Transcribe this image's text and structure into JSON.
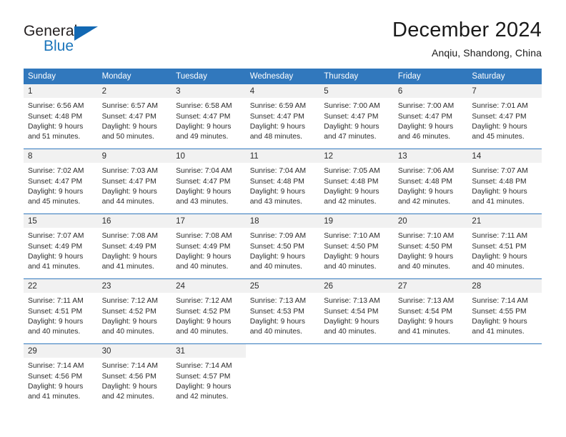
{
  "logo": {
    "word_top": "General",
    "word_bottom": "Blue",
    "triangle_color": "#1268b3",
    "blue_color": "#1b75bb"
  },
  "header": {
    "title": "December 2024",
    "subtitle": "Anqiu, Shandong, China"
  },
  "theme": {
    "header_blue": "#3178bd",
    "day_strip_gray": "#f1f1f1",
    "text": "#2b2b2b"
  },
  "calendar": {
    "weekdays": [
      "Sunday",
      "Monday",
      "Tuesday",
      "Wednesday",
      "Thursday",
      "Friday",
      "Saturday"
    ],
    "weeks": [
      [
        {
          "day": "1",
          "l1": "Sunrise: 6:56 AM",
          "l2": "Sunset: 4:48 PM",
          "l3": "Daylight: 9 hours",
          "l4": "and 51 minutes."
        },
        {
          "day": "2",
          "l1": "Sunrise: 6:57 AM",
          "l2": "Sunset: 4:47 PM",
          "l3": "Daylight: 9 hours",
          "l4": "and 50 minutes."
        },
        {
          "day": "3",
          "l1": "Sunrise: 6:58 AM",
          "l2": "Sunset: 4:47 PM",
          "l3": "Daylight: 9 hours",
          "l4": "and 49 minutes."
        },
        {
          "day": "4",
          "l1": "Sunrise: 6:59 AM",
          "l2": "Sunset: 4:47 PM",
          "l3": "Daylight: 9 hours",
          "l4": "and 48 minutes."
        },
        {
          "day": "5",
          "l1": "Sunrise: 7:00 AM",
          "l2": "Sunset: 4:47 PM",
          "l3": "Daylight: 9 hours",
          "l4": "and 47 minutes."
        },
        {
          "day": "6",
          "l1": "Sunrise: 7:00 AM",
          "l2": "Sunset: 4:47 PM",
          "l3": "Daylight: 9 hours",
          "l4": "and 46 minutes."
        },
        {
          "day": "7",
          "l1": "Sunrise: 7:01 AM",
          "l2": "Sunset: 4:47 PM",
          "l3": "Daylight: 9 hours",
          "l4": "and 45 minutes."
        }
      ],
      [
        {
          "day": "8",
          "l1": "Sunrise: 7:02 AM",
          "l2": "Sunset: 4:47 PM",
          "l3": "Daylight: 9 hours",
          "l4": "and 45 minutes."
        },
        {
          "day": "9",
          "l1": "Sunrise: 7:03 AM",
          "l2": "Sunset: 4:47 PM",
          "l3": "Daylight: 9 hours",
          "l4": "and 44 minutes."
        },
        {
          "day": "10",
          "l1": "Sunrise: 7:04 AM",
          "l2": "Sunset: 4:47 PM",
          "l3": "Daylight: 9 hours",
          "l4": "and 43 minutes."
        },
        {
          "day": "11",
          "l1": "Sunrise: 7:04 AM",
          "l2": "Sunset: 4:48 PM",
          "l3": "Daylight: 9 hours",
          "l4": "and 43 minutes."
        },
        {
          "day": "12",
          "l1": "Sunrise: 7:05 AM",
          "l2": "Sunset: 4:48 PM",
          "l3": "Daylight: 9 hours",
          "l4": "and 42 minutes."
        },
        {
          "day": "13",
          "l1": "Sunrise: 7:06 AM",
          "l2": "Sunset: 4:48 PM",
          "l3": "Daylight: 9 hours",
          "l4": "and 42 minutes."
        },
        {
          "day": "14",
          "l1": "Sunrise: 7:07 AM",
          "l2": "Sunset: 4:48 PM",
          "l3": "Daylight: 9 hours",
          "l4": "and 41 minutes."
        }
      ],
      [
        {
          "day": "15",
          "l1": "Sunrise: 7:07 AM",
          "l2": "Sunset: 4:49 PM",
          "l3": "Daylight: 9 hours",
          "l4": "and 41 minutes."
        },
        {
          "day": "16",
          "l1": "Sunrise: 7:08 AM",
          "l2": "Sunset: 4:49 PM",
          "l3": "Daylight: 9 hours",
          "l4": "and 41 minutes."
        },
        {
          "day": "17",
          "l1": "Sunrise: 7:08 AM",
          "l2": "Sunset: 4:49 PM",
          "l3": "Daylight: 9 hours",
          "l4": "and 40 minutes."
        },
        {
          "day": "18",
          "l1": "Sunrise: 7:09 AM",
          "l2": "Sunset: 4:50 PM",
          "l3": "Daylight: 9 hours",
          "l4": "and 40 minutes."
        },
        {
          "day": "19",
          "l1": "Sunrise: 7:10 AM",
          "l2": "Sunset: 4:50 PM",
          "l3": "Daylight: 9 hours",
          "l4": "and 40 minutes."
        },
        {
          "day": "20",
          "l1": "Sunrise: 7:10 AM",
          "l2": "Sunset: 4:50 PM",
          "l3": "Daylight: 9 hours",
          "l4": "and 40 minutes."
        },
        {
          "day": "21",
          "l1": "Sunrise: 7:11 AM",
          "l2": "Sunset: 4:51 PM",
          "l3": "Daylight: 9 hours",
          "l4": "and 40 minutes."
        }
      ],
      [
        {
          "day": "22",
          "l1": "Sunrise: 7:11 AM",
          "l2": "Sunset: 4:51 PM",
          "l3": "Daylight: 9 hours",
          "l4": "and 40 minutes."
        },
        {
          "day": "23",
          "l1": "Sunrise: 7:12 AM",
          "l2": "Sunset: 4:52 PM",
          "l3": "Daylight: 9 hours",
          "l4": "and 40 minutes."
        },
        {
          "day": "24",
          "l1": "Sunrise: 7:12 AM",
          "l2": "Sunset: 4:52 PM",
          "l3": "Daylight: 9 hours",
          "l4": "and 40 minutes."
        },
        {
          "day": "25",
          "l1": "Sunrise: 7:13 AM",
          "l2": "Sunset: 4:53 PM",
          "l3": "Daylight: 9 hours",
          "l4": "and 40 minutes."
        },
        {
          "day": "26",
          "l1": "Sunrise: 7:13 AM",
          "l2": "Sunset: 4:54 PM",
          "l3": "Daylight: 9 hours",
          "l4": "and 40 minutes."
        },
        {
          "day": "27",
          "l1": "Sunrise: 7:13 AM",
          "l2": "Sunset: 4:54 PM",
          "l3": "Daylight: 9 hours",
          "l4": "and 41 minutes."
        },
        {
          "day": "28",
          "l1": "Sunrise: 7:14 AM",
          "l2": "Sunset: 4:55 PM",
          "l3": "Daylight: 9 hours",
          "l4": "and 41 minutes."
        }
      ],
      [
        {
          "day": "29",
          "l1": "Sunrise: 7:14 AM",
          "l2": "Sunset: 4:56 PM",
          "l3": "Daylight: 9 hours",
          "l4": "and 41 minutes."
        },
        {
          "day": "30",
          "l1": "Sunrise: 7:14 AM",
          "l2": "Sunset: 4:56 PM",
          "l3": "Daylight: 9 hours",
          "l4": "and 42 minutes."
        },
        {
          "day": "31",
          "l1": "Sunrise: 7:14 AM",
          "l2": "Sunset: 4:57 PM",
          "l3": "Daylight: 9 hours",
          "l4": "and 42 minutes."
        },
        {
          "day": "",
          "l1": "",
          "l2": "",
          "l3": "",
          "l4": ""
        },
        {
          "day": "",
          "l1": "",
          "l2": "",
          "l3": "",
          "l4": ""
        },
        {
          "day": "",
          "l1": "",
          "l2": "",
          "l3": "",
          "l4": ""
        },
        {
          "day": "",
          "l1": "",
          "l2": "",
          "l3": "",
          "l4": ""
        }
      ]
    ]
  }
}
